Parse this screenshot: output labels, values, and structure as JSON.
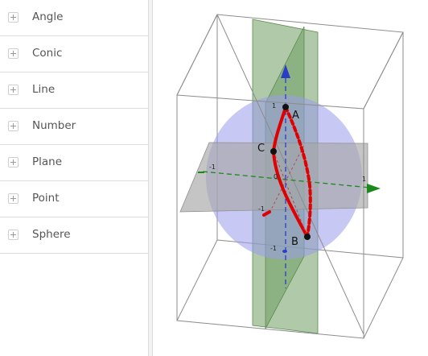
{
  "algebra": {
    "groups": [
      {
        "label": "Angle"
      },
      {
        "label": "Conic"
      },
      {
        "label": "Line"
      },
      {
        "label": "Number"
      },
      {
        "label": "Plane"
      },
      {
        "label": "Point"
      },
      {
        "label": "Sphere"
      }
    ]
  },
  "graphics": {
    "points": {
      "A": "A",
      "B": "B",
      "C": "C"
    },
    "ticks": {
      "z_pos": "1",
      "z_neg": "-1",
      "x_neg": "-1",
      "x_pos": "1",
      "y_pos": "-1",
      "origin": "0"
    },
    "colors": {
      "sphere": "#9a9aec",
      "plane_green": "#6f9c63",
      "plane_gray": "#a6a6a6",
      "curve_red": "#e00000",
      "axis_blue": "#2a3dc7",
      "axis_green": "#1a8a1a"
    }
  }
}
